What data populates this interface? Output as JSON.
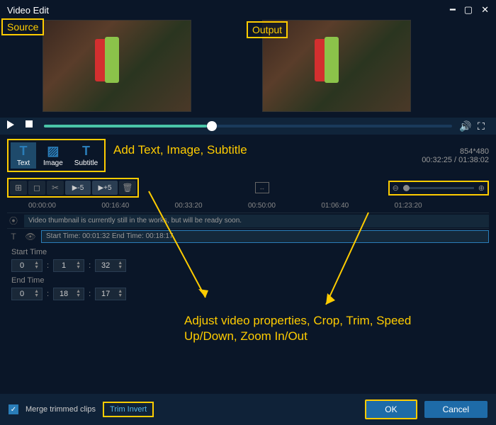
{
  "title": "Video Edit",
  "labels": {
    "source": "Source",
    "output": "Output"
  },
  "playback": {
    "position_pct": 40
  },
  "tools": {
    "items": [
      {
        "icon": "T",
        "label": "Text"
      },
      {
        "icon": "▨",
        "label": "Image"
      },
      {
        "icon": "T",
        "label": "Subtitle"
      }
    ],
    "annotation": "Add Text, Image, Subtitle"
  },
  "resolution": "854*480",
  "timecode": "00:32:25 / 01:38:02",
  "edit_toolbar": {
    "speed_down": "▶-5",
    "speed_up": "▶+5"
  },
  "timeline_ticks": [
    "00:00:00",
    "00:16:40",
    "00:33:20",
    "00:50:00",
    "01:06:40",
    "01:23:20"
  ],
  "tracks": {
    "thumbnail_msg": "Video thumbnail is currently still in the works, but will be ready soon.",
    "clip_times": "Start Time: 00:01:32   End Time: 00:18:17"
  },
  "time_fields": {
    "start_label": "Start Time",
    "start": {
      "h": "0",
      "m": "1",
      "s": "32"
    },
    "end_label": "End Time",
    "end": {
      "h": "0",
      "m": "18",
      "s": "17"
    }
  },
  "annotation_adjust": "Adjust video properties, Crop, Trim, Speed Up/Down, Zoom In/Out",
  "bottom": {
    "merge_label": "Merge trimmed clips",
    "trim_invert": "Trim Invert",
    "ok": "OK",
    "cancel": "Cancel"
  }
}
